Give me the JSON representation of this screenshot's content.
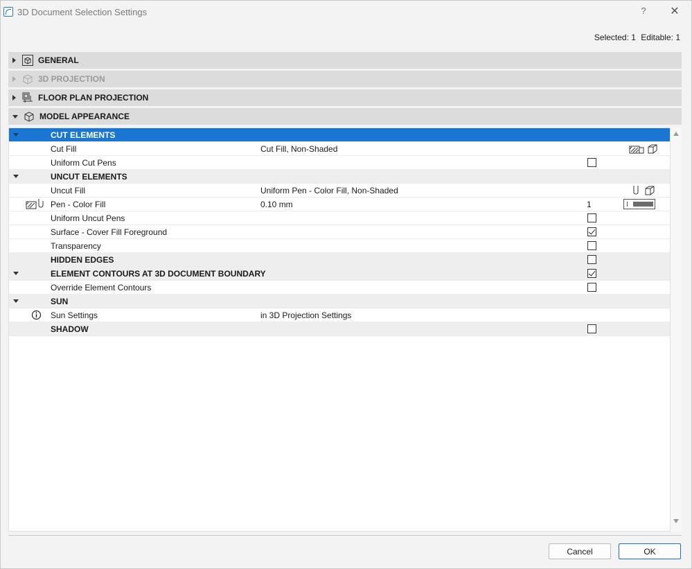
{
  "window": {
    "title": "3D Document Selection Settings",
    "help_glyph": "?",
    "close_glyph": "✕"
  },
  "selection": {
    "selected": "Selected: 1",
    "editable": "Editable: 1"
  },
  "panels": [
    {
      "label": "GENERAL",
      "expanded": false,
      "enabled": true
    },
    {
      "label": "3D PROJECTION",
      "expanded": false,
      "enabled": false
    },
    {
      "label": "FLOOR PLAN PROJECTION",
      "expanded": false,
      "enabled": true
    },
    {
      "label": "MODEL APPEARANCE",
      "expanded": true,
      "enabled": true
    }
  ],
  "rows": {
    "cut_elements": {
      "label": "CUT ELEMENTS"
    },
    "cut_fill": {
      "label": "Cut Fill",
      "value": "Cut Fill, Non-Shaded"
    },
    "uniform_cut_pens": {
      "label": "Uniform Cut Pens",
      "checked": false
    },
    "uncut_elements": {
      "label": "UNCUT ELEMENTS"
    },
    "uncut_fill": {
      "label": "Uncut Fill",
      "value": "Uniform Pen - Color Fill, Non-Shaded"
    },
    "pen_color_fill": {
      "label": "Pen - Color Fill",
      "value": "0.10 mm",
      "pen_number": "1"
    },
    "uniform_uncut_pens": {
      "label": "Uniform Uncut Pens",
      "checked": false
    },
    "surface_cover_fill": {
      "label": "Surface - Cover Fill Foreground",
      "checked": true
    },
    "transparency": {
      "label": "Transparency",
      "checked": false
    },
    "hidden_edges": {
      "label": "HIDDEN EDGES",
      "checked": false
    },
    "element_contours": {
      "label": "ELEMENT CONTOURS AT 3D DOCUMENT BOUNDARY",
      "checked": true
    },
    "override_contours": {
      "label": "Override Element Contours",
      "checked": false
    },
    "sun": {
      "label": "SUN"
    },
    "sun_settings": {
      "label": "Sun Settings",
      "value": "in 3D Projection Settings"
    },
    "shadow": {
      "label": "SHADOW",
      "checked": false
    }
  },
  "footer": {
    "cancel_label": "Cancel",
    "ok_label": "OK"
  },
  "colors": {
    "selection_blue": "#1976d2",
    "panel_gray": "#dcdcdc",
    "group_gray": "#eeeeee"
  }
}
